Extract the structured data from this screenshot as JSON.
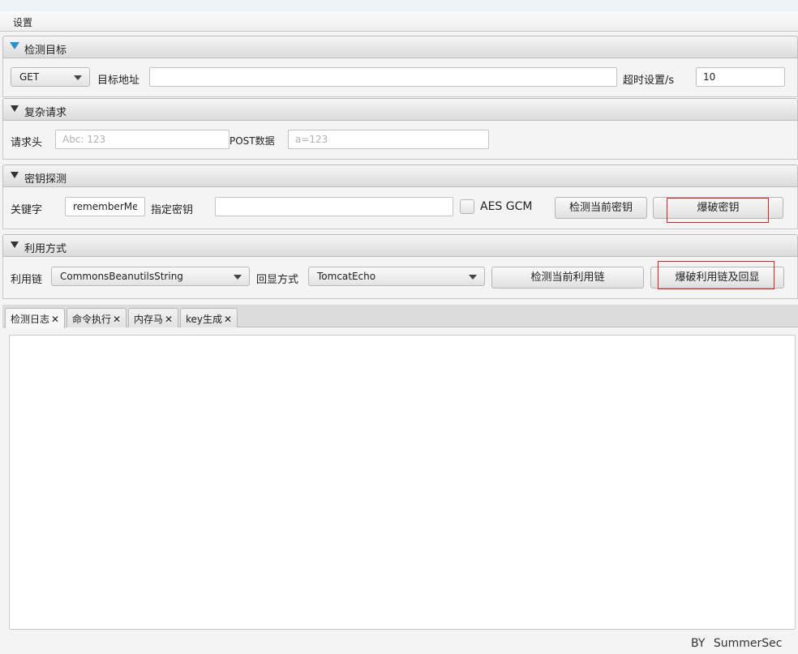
{
  "menubar": {
    "settings": "设置"
  },
  "target_pane": {
    "title": "检测目标",
    "method": "GET",
    "url_label": "目标地址",
    "url_value": "",
    "timeout_label": "超时设置/s",
    "timeout_value": "10"
  },
  "complex_request_pane": {
    "title": "复杂请求",
    "headers_label": "请求头",
    "headers_placeholder": "Abc: 123",
    "post_label": "POST数据",
    "post_placeholder": "a=123"
  },
  "key_pane": {
    "title": "密钥探测",
    "keyword_label": "关键字",
    "keyword_value": "rememberMe",
    "specify_key_label": "指定密钥",
    "specify_key_value": "",
    "aes_gcm_label": "AES GCM",
    "check_key_button": "检测当前密钥",
    "brute_key_button": "爆破密钥"
  },
  "exploit_pane": {
    "title": "利用方式",
    "chain_label": "利用链",
    "chain_value": "CommonsBeanutilsString",
    "echo_label": "回显方式",
    "echo_value": "TomcatEcho",
    "check_chain_button": "检测当前利用链",
    "brute_chain_button": "爆破利用链及回显"
  },
  "tabs": [
    {
      "label": "检测日志",
      "close": "✕"
    },
    {
      "label": "命令执行",
      "close": "✕"
    },
    {
      "label": "内存马",
      "close": "✕"
    },
    {
      "label": "key生成",
      "close": "✕"
    }
  ],
  "footer": {
    "credit": "BY SummerSec"
  },
  "colors": {
    "highlight": "#e02020",
    "accent_arrow": "#2a8ec9"
  }
}
